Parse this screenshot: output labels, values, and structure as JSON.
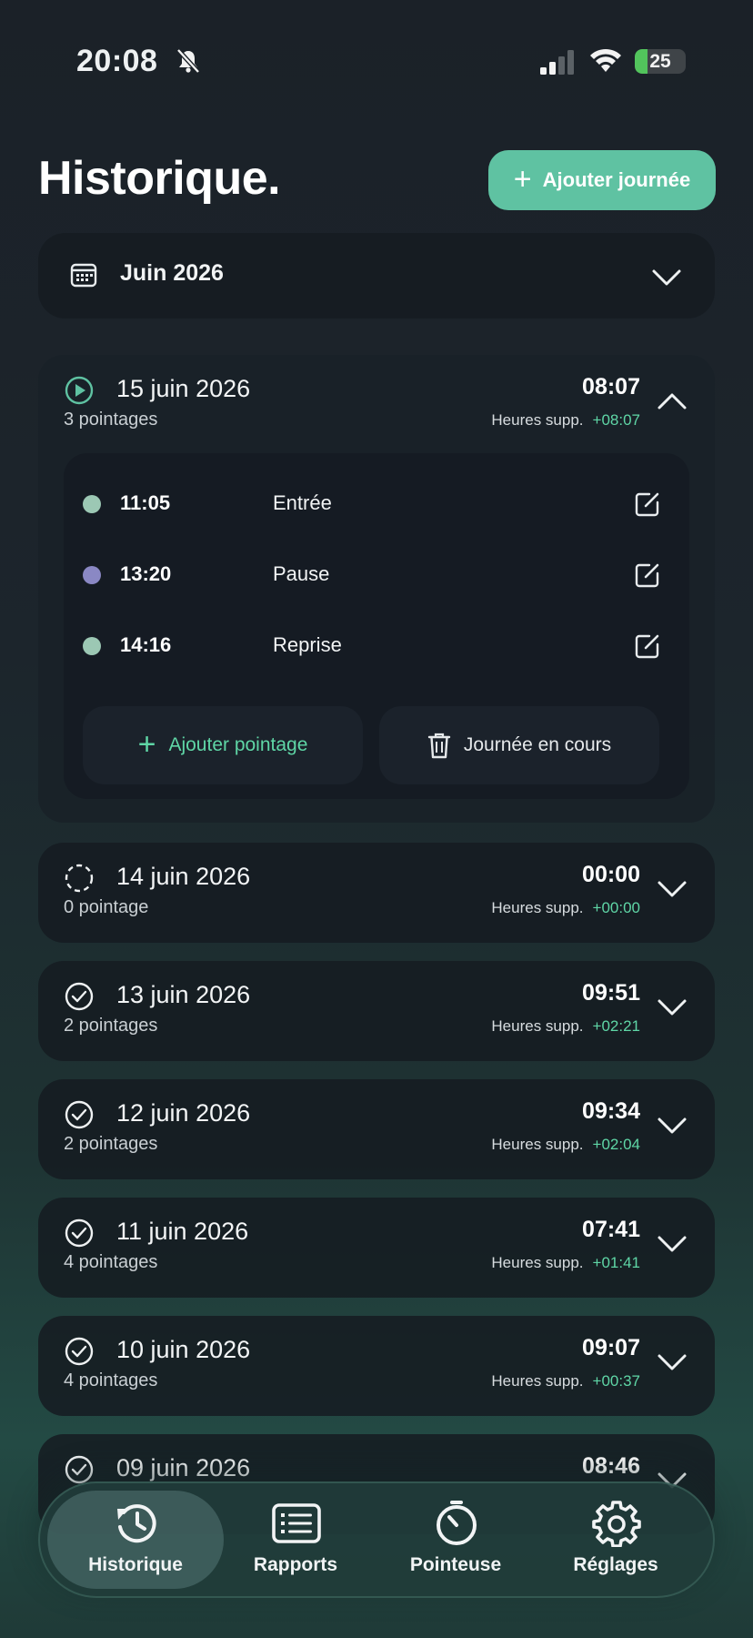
{
  "status_bar": {
    "time": "20:08",
    "battery": "25",
    "battery_level": 0.25
  },
  "header": {
    "title": "Historique.",
    "add_day_label": "Ajouter journée"
  },
  "month": {
    "label": "Juin 2026"
  },
  "days": [
    {
      "date": "15 juin 2026",
      "count": "3 pointages",
      "total": "08:07",
      "ot_label": "Heures supp.",
      "ot_value": "+08:07",
      "status": "in-progress",
      "expanded": true,
      "punches": [
        {
          "time": "11:05",
          "label": "Entrée",
          "color": "#9cc8b4"
        },
        {
          "time": "13:20",
          "label": "Pause",
          "color": "#8a88c4"
        },
        {
          "time": "14:16",
          "label": "Reprise",
          "color": "#9cc8b4"
        }
      ],
      "add_punch_label": "Ajouter pointage",
      "delete_label": "Journée en cours"
    },
    {
      "date": "14 juin 2026",
      "count": "0 pointage",
      "total": "00:00",
      "ot_label": "Heures supp.",
      "ot_value": "+00:00",
      "status": "empty"
    },
    {
      "date": "13 juin 2026",
      "count": "2 pointages",
      "total": "09:51",
      "ot_label": "Heures supp.",
      "ot_value": "+02:21",
      "status": "complete"
    },
    {
      "date": "12 juin 2026",
      "count": "2 pointages",
      "total": "09:34",
      "ot_label": "Heures supp.",
      "ot_value": "+02:04",
      "status": "complete"
    },
    {
      "date": "11 juin 2026",
      "count": "4 pointages",
      "total": "07:41",
      "ot_label": "Heures supp.",
      "ot_value": "+01:41",
      "status": "complete"
    },
    {
      "date": "10 juin 2026",
      "count": "4 pointages",
      "total": "09:07",
      "ot_label": "Heures supp.",
      "ot_value": "+00:37",
      "status": "complete"
    },
    {
      "date": "09 juin 2026",
      "total": "08:46",
      "status": "complete"
    }
  ],
  "nav": [
    {
      "label": "Historique",
      "icon": "history-icon",
      "active": true
    },
    {
      "label": "Rapports",
      "icon": "report-icon",
      "active": false
    },
    {
      "label": "Pointeuse",
      "icon": "stopwatch-icon",
      "active": false
    },
    {
      "label": "Réglages",
      "icon": "gear-icon",
      "active": false
    }
  ],
  "colors": {
    "accent": "#5fc2a2",
    "overtime": "#5fd6a6"
  }
}
